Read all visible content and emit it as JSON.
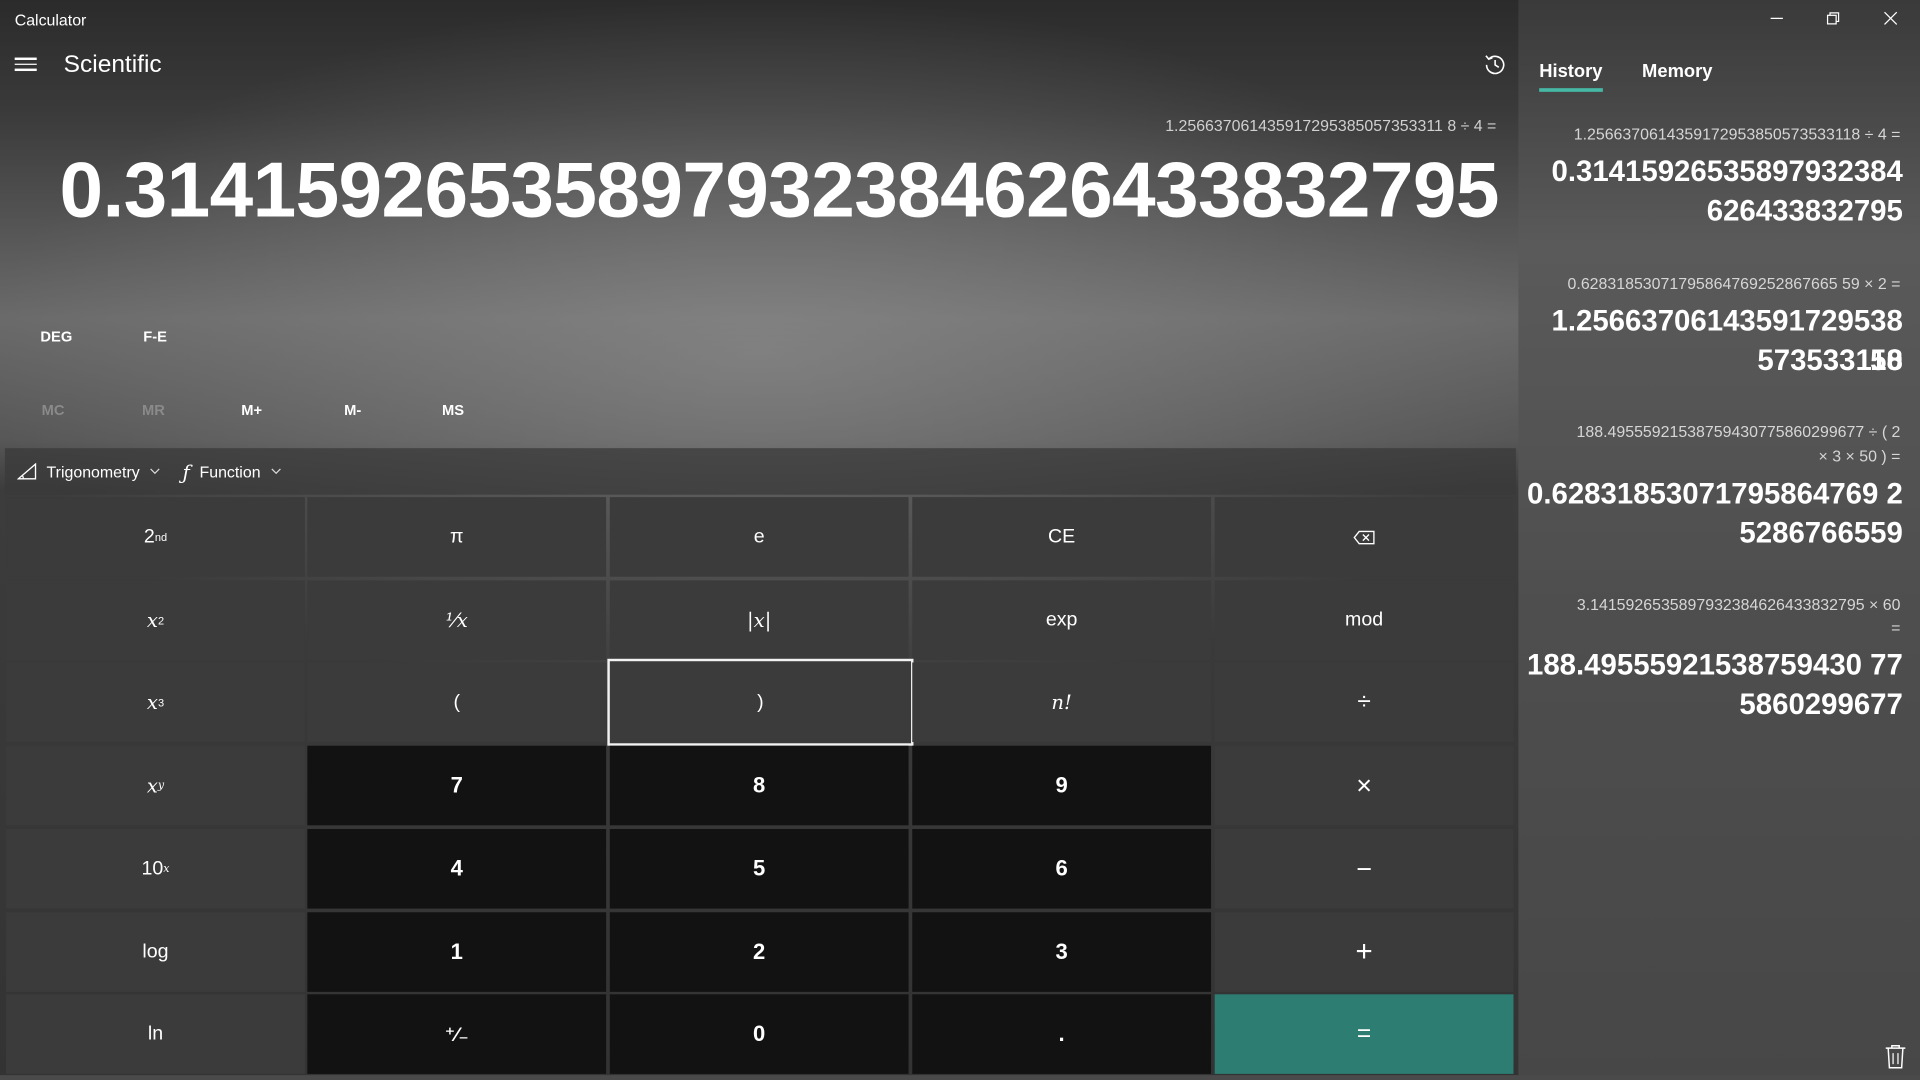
{
  "window": {
    "title": "Calculator",
    "minimize_icon": "minimize-icon",
    "restore_icon": "restore-icon",
    "close_icon": "close-icon"
  },
  "header": {
    "mode": "Scientific"
  },
  "display": {
    "expression": "1.256637061435917295385057353311 8 ÷ 4 =",
    "result": "0.31415926535897932384626433832795"
  },
  "modes": {
    "angle": "DEG",
    "notation": "F-E"
  },
  "memory": {
    "buttons": [
      "MC",
      "MR",
      "M+",
      "M-",
      "MS"
    ]
  },
  "functions": {
    "trig_label": "Trigonometry",
    "func_label": "Function"
  },
  "keys": {
    "second": "2",
    "second_sup": "nd",
    "pi": "π",
    "e": "e",
    "ce": "CE",
    "backspace_icon": "backspace-icon",
    "square": "x",
    "square_sup": "2",
    "reciprocal": "⅟x",
    "abs": "|x|",
    "exp": "exp",
    "mod": "mod",
    "cube": "x",
    "cube_sup": "3",
    "open_paren": "(",
    "close_paren": ")",
    "factorial": "n!",
    "divide": "÷",
    "power": "x",
    "power_sup": "y",
    "seven": "7",
    "eight": "8",
    "nine": "9",
    "multiply": "×",
    "ten_pow": "10",
    "ten_pow_sup": "x",
    "four": "4",
    "five": "5",
    "six": "6",
    "minus": "−",
    "log": "log",
    "one": "1",
    "two": "2",
    "three": "3",
    "plus": "+",
    "ln": "ln",
    "negate": "⁺∕₋",
    "zero": "0",
    "decimal": ".",
    "equals": "="
  },
  "panel": {
    "tabs": [
      "History",
      "Memory"
    ],
    "history": [
      {
        "expression_lines": [
          "1.2566370614359172953850573533118   ÷   4 ="
        ],
        "result_lines": [
          "0.31415926535897932384",
          "626433832795"
        ]
      },
      {
        "expression_lines": [
          "0.62831853071795864769252867665 59   ×   2 ="
        ],
        "result_lines": [
          "1.25663706143591729538 50",
          "573533118"
        ]
      },
      {
        "expression_lines": [
          "188.49555921538759430775860299677   ÷   ( 2",
          "×   3   ×   50 ) ="
        ],
        "result_lines": [
          "0.62831853071795864769 2",
          "5286766559"
        ]
      },
      {
        "expression_lines": [
          "3.1415926535897932384626433832795   ×   60",
          "="
        ],
        "result_lines": [
          "188.49555921538759430 77",
          "5860299677"
        ]
      }
    ],
    "trash_icon": "trash-icon"
  }
}
